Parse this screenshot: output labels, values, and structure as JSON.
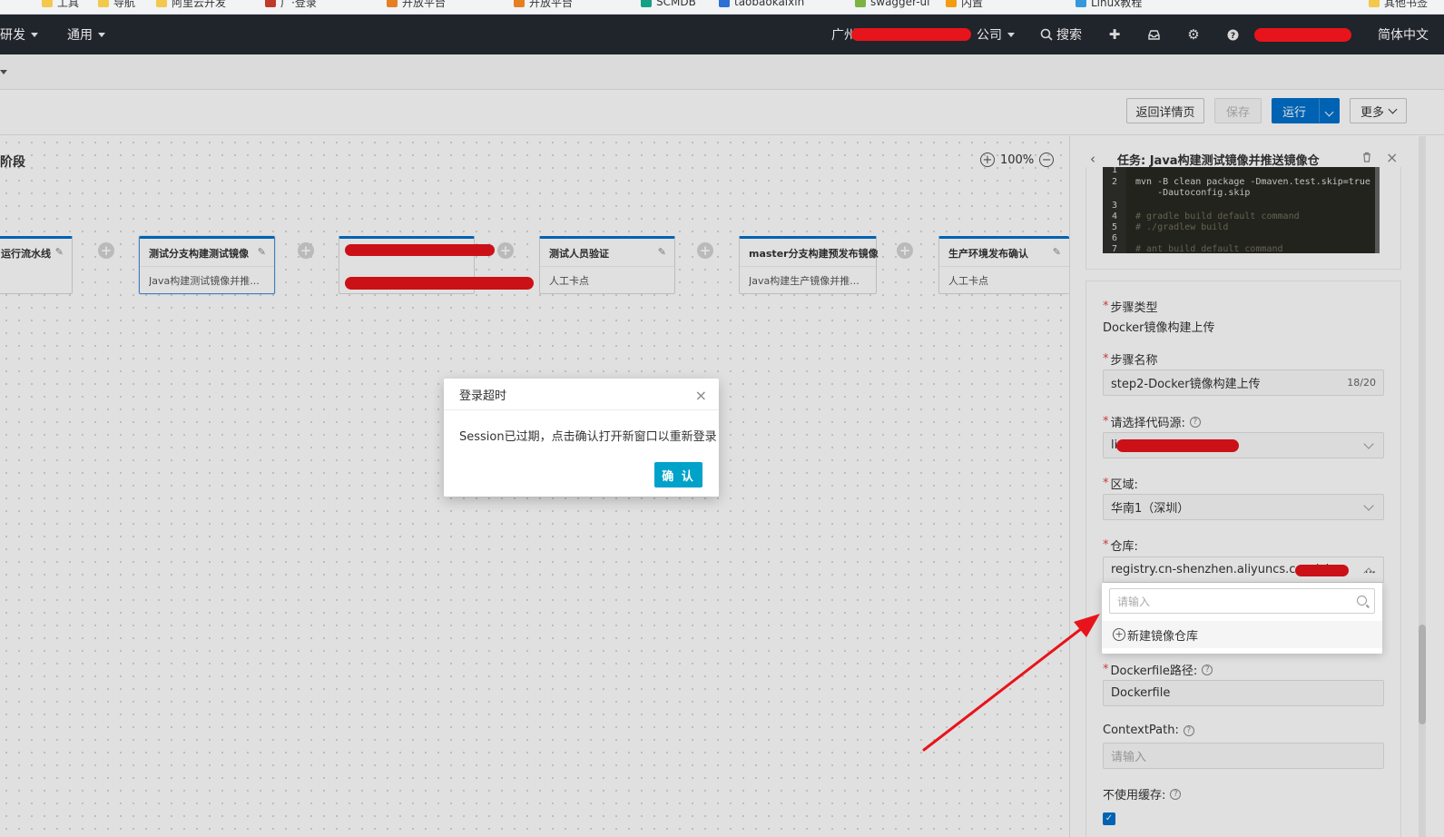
{
  "bookmarks": [
    "工具",
    "导航",
    "阿里云开发",
    "广·登录",
    "开放平台",
    "开放平台",
    "SCMDB",
    "taobaokaixin",
    "swagger-ui",
    "内置",
    "Linux教程",
    "其他书签"
  ],
  "topnav": {
    "items": [
      "研发",
      "通用"
    ],
    "org": "广州",
    "org_suffix": "公司",
    "search": "搜索",
    "lang": "简体中文"
  },
  "toolbar": {
    "back": "返回详情页",
    "save": "保存",
    "run": "运行",
    "more": "更多"
  },
  "canvas": {
    "stage_title": "阶段",
    "zoom": "100%",
    "nodes": [
      {
        "title": "运行流水线",
        "desc": ""
      },
      {
        "title": "测试分支构建测试镜像",
        "desc": "Java构建测试镜像并推..."
      },
      {
        "title": "",
        "desc": ""
      },
      {
        "title": "测试人员验证",
        "desc": "人工卡点"
      },
      {
        "title": "master分支构建预发布镜像",
        "desc": "Java构建生产镜像并推..."
      },
      {
        "title": "生产环境发布确认",
        "desc": "人工卡点"
      }
    ]
  },
  "modal": {
    "title": "登录超时",
    "body": "Session已过期，点击确认打开新窗口以重新登录",
    "ok": "确 认"
  },
  "panel": {
    "title": "任务: Java构建测试镜像并推送镜像仓",
    "code_lines": [
      {
        "n": "1",
        "text": ""
      },
      {
        "n": "2",
        "text": "mvn -B clean package -Dmaven.test.skip=true"
      },
      {
        "n": "",
        "text": "    -Dautoconfig.skip"
      },
      {
        "n": "3",
        "text": ""
      },
      {
        "n": "4",
        "text": "# gradle build default command"
      },
      {
        "n": "5",
        "text": "# ./gradlew build"
      },
      {
        "n": "6",
        "text": ""
      },
      {
        "n": "7",
        "text": "# ant build default command"
      }
    ],
    "step_type_label": "步骤类型",
    "step_type_value": "Docker镜像构建上传",
    "step_name_label": "步骤名称",
    "step_name_value": "step2-Docker镜像构建上传",
    "step_name_count": "18/20",
    "source_label": "请选择代码源:",
    "source_value": "liv",
    "region_label": "区域:",
    "region_value": "华南1（深圳）",
    "repo_label": "仓库:",
    "repo_value": "registry.cn-shenzhen.aliyuncs.com/pla",
    "repo_suffix": "...",
    "dockerfile_label": "Dockerfile路径:",
    "dockerfile_value": "Dockerfile",
    "context_label": "ContextPath:",
    "context_placeholder": "请输入",
    "nocache_label": "不使用缓存:"
  },
  "dropdown": {
    "search_placeholder": "请输入",
    "new_repo": "新建镜像仓库"
  },
  "colors": {
    "nav_bg": "#20242b",
    "primary": "#0070cc",
    "confirm": "#00a2ca",
    "annotation": "#e8141b"
  }
}
